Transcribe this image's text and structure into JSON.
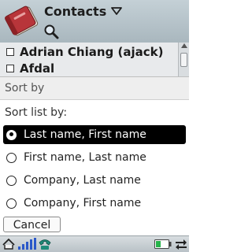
{
  "header": {
    "title": "Contacts",
    "app_icon": "contacts-book-icon",
    "dropdown_icon": "triangle-down-icon",
    "search_icon": "magnifier-icon"
  },
  "contacts": [
    {
      "name": "Adrian Chiang (ajack)"
    },
    {
      "name": "Afdal"
    }
  ],
  "dialog": {
    "title": "Sort by",
    "prompt": "Sort list by:",
    "options": [
      {
        "label": "Last name, First name",
        "selected": true
      },
      {
        "label": "First name, Last name",
        "selected": false
      },
      {
        "label": "Company, Last name",
        "selected": false
      },
      {
        "label": "Company, First name",
        "selected": false
      }
    ],
    "cancel_label": "Cancel"
  },
  "statusbar": {
    "icons": [
      "home-icon",
      "signal-strength-icon",
      "phone-icon",
      "battery-icon",
      "transfer-arrows-icon"
    ]
  },
  "colors": {
    "header_bg": "#b6c2c8",
    "selection_bg": "#000000",
    "book_red": "#b33232"
  }
}
